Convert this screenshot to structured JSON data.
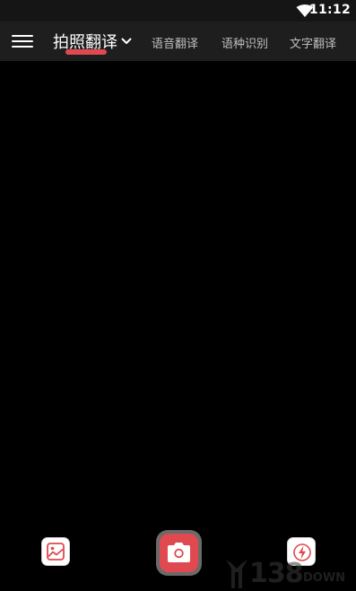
{
  "status_bar": {
    "time": "11:12",
    "wifi_icon": "wifi-icon"
  },
  "app_bar": {
    "menu_icon": "menu-icon",
    "current_mode": "拍照翻译",
    "dropdown_icon": "chevron-down-icon",
    "tabs": [
      {
        "label": "语音翻译"
      },
      {
        "label": "语种识别"
      },
      {
        "label": "文字翻译"
      }
    ]
  },
  "bottom_controls": {
    "gallery_icon": "gallery-icon",
    "shutter_icon": "camera-icon",
    "flash_icon": "flash-icon"
  },
  "watermark": {
    "number": "138",
    "suffix": "DOWN"
  },
  "colors": {
    "accent": "#e0494f",
    "app_bar_bg": "#1e1e1e",
    "status_bar_bg": "#151515",
    "viewfinder_bg": "#000000"
  }
}
